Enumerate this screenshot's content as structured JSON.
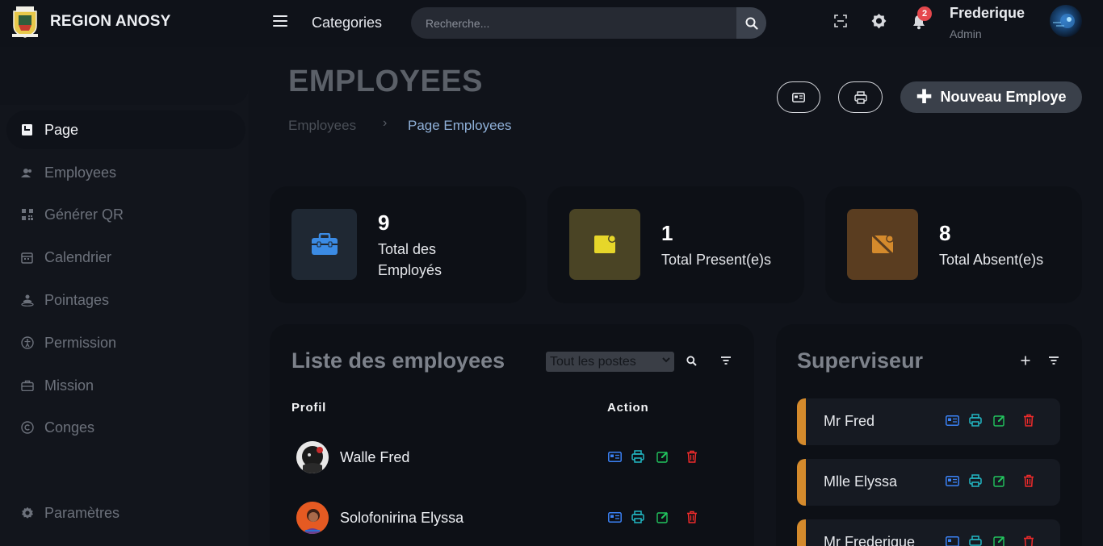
{
  "brand": {
    "name": "REGION ANOSY"
  },
  "topbar": {
    "categories_label": "Categories",
    "search_placeholder": "Recherche...",
    "notification_count": "2",
    "user_name": "Frederique",
    "user_role": "Admin"
  },
  "sidebar": {
    "items": [
      {
        "label": "Page",
        "icon": "book-icon"
      },
      {
        "label": "Employees",
        "icon": "users-icon"
      },
      {
        "label": "Générer QR",
        "icon": "qr-code-icon"
      },
      {
        "label": "Calendrier",
        "icon": "calendar-icon"
      },
      {
        "label": "Pointages",
        "icon": "fingerprint-icon"
      },
      {
        "label": "Permission",
        "icon": "accessibility-icon"
      },
      {
        "label": "Mission",
        "icon": "briefcase-icon"
      },
      {
        "label": "Conges",
        "icon": "copyright-icon"
      }
    ],
    "settings_label": "Paramètres"
  },
  "header": {
    "title": "EMPLOYEES",
    "breadcrumb": [
      "Employees",
      "Page Employees"
    ],
    "new_button_label": "Nouveau Employe"
  },
  "stats": [
    {
      "value": "9",
      "label_line1": "Total des",
      "label_line2": "Employés",
      "icon": "briefcase-icon",
      "color": "#3b7fd6"
    },
    {
      "value": "1",
      "label_line1": "Total Present(e)s",
      "label_line2": "",
      "icon": "note-icon",
      "color": "#e0d424"
    },
    {
      "value": "8",
      "label_line1": "Total Absent(e)s",
      "label_line2": "",
      "icon": "note-off-icon",
      "color": "#d48a2c"
    }
  ],
  "employees_panel": {
    "title": "Liste des employees",
    "filter_selected": "Tout les postes",
    "columns": [
      "Profil",
      "Action"
    ],
    "rows": [
      {
        "name": "Walle Fred"
      },
      {
        "name": "Solofonirina Elyssa"
      }
    ]
  },
  "supervisor_panel": {
    "title": "Superviseur",
    "rows": [
      {
        "name": "Mr Fred"
      },
      {
        "name": "Mlle Elyssa"
      },
      {
        "name": "Mr Frederique"
      }
    ]
  },
  "colors": {
    "accent_blue": "#3b82f6",
    "accent_teal": "#22b8c4",
    "accent_green": "#22c55e",
    "accent_red": "#ef2b2b",
    "supervisor_bar": "#d48a2c"
  }
}
